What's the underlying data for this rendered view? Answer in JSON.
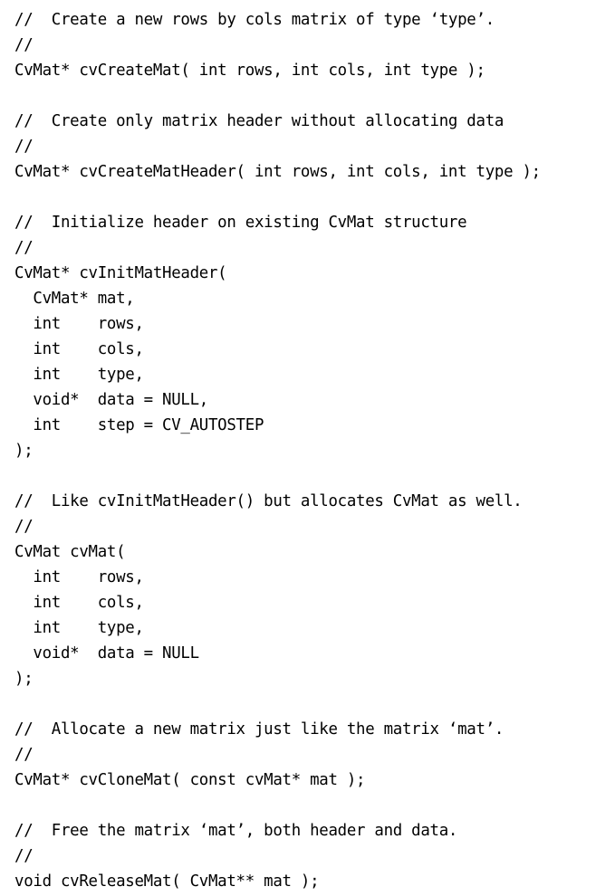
{
  "document": {
    "kind": "code-listing",
    "language": "C",
    "background_color": "#ffffff",
    "text_color": "#000000",
    "blocks": [
      {
        "name": "cvCreateMat",
        "lines": [
          "//  Create a new rows by cols matrix of type ‘type’.",
          "//",
          "CvMat* cvCreateMat( int rows, int cols, int type );"
        ]
      },
      {
        "name": "cvCreateMatHeader",
        "lines": [
          "//  Create only matrix header without allocating data",
          "//",
          "CvMat* cvCreateMatHeader( int rows, int cols, int type );"
        ]
      },
      {
        "name": "cvInitMatHeader",
        "lines": [
          "//  Initialize header on existing CvMat structure",
          "//",
          "CvMat* cvInitMatHeader(",
          "  CvMat* mat,",
          "  int    rows,",
          "  int    cols,",
          "  int    type,",
          "  void*  data = NULL,",
          "  int    step = CV_AUTOSTEP",
          ");"
        ]
      },
      {
        "name": "cvMat",
        "lines": [
          "//  Like cvInitMatHeader() but allocates CvMat as well.",
          "//",
          "CvMat cvMat(",
          "  int    rows,",
          "  int    cols,",
          "  int    type,",
          "  void*  data = NULL",
          ");"
        ]
      },
      {
        "name": "cvCloneMat",
        "lines": [
          "//  Allocate a new matrix just like the matrix ‘mat’.",
          "//",
          "CvMat* cvCloneMat( const cvMat* mat );"
        ]
      },
      {
        "name": "cvReleaseMat",
        "lines": [
          "//  Free the matrix ‘mat’, both header and data.",
          "//",
          "void cvReleaseMat( CvMat** mat );"
        ]
      }
    ]
  }
}
